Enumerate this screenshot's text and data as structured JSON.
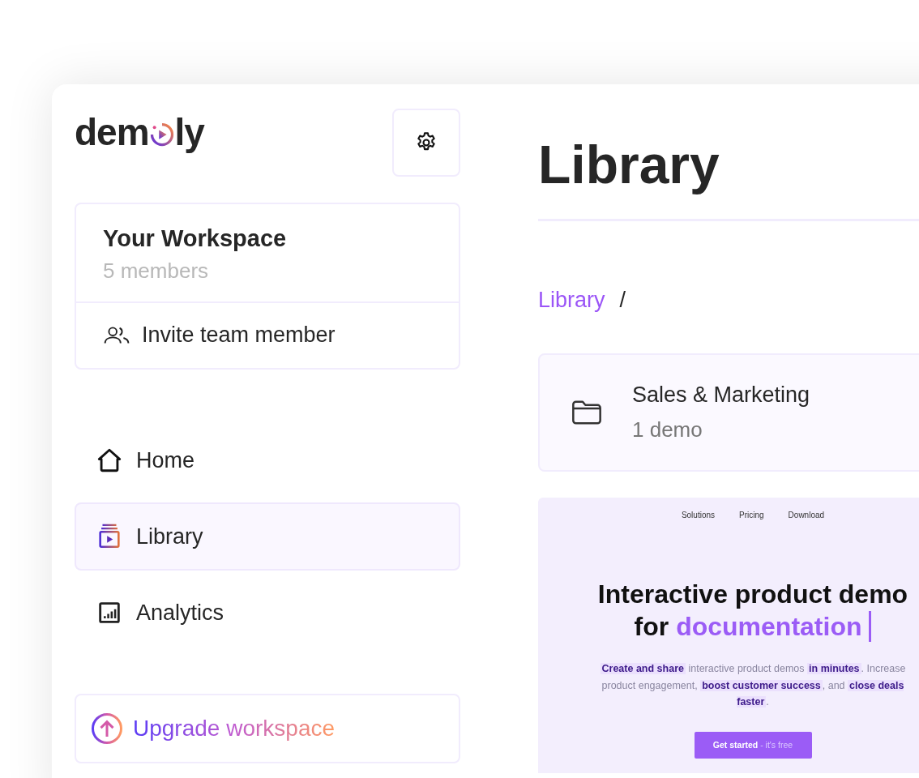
{
  "logo": {
    "before": "dem",
    "after": "ly"
  },
  "workspace": {
    "name": "Your Workspace",
    "members": "5 members",
    "invite": "Invite team member"
  },
  "nav": [
    {
      "kind": "home",
      "label": "Home",
      "selected": false
    },
    {
      "kind": "library",
      "label": "Library",
      "selected": true
    },
    {
      "kind": "analytics",
      "label": "Analytics",
      "selected": false
    }
  ],
  "upgrade": {
    "label": "Upgrade workspace"
  },
  "main": {
    "title": "Library",
    "breadcrumb": {
      "link": "Library",
      "separator": "/"
    },
    "folder": {
      "name": "Sales & Marketing",
      "count": "1 demo"
    },
    "preview": {
      "nav": [
        "Solutions",
        "Pricing",
        "Download"
      ],
      "headline": "Interactive product demo",
      "headline_prefix": "for",
      "headline_highlight": "documentation",
      "text": "**Create and share** interactive product demos **in minutes**. Increase product engagement, **boost customer success**, and **close deals faster**.",
      "cta": "**Get started** - it's free"
    }
  }
}
